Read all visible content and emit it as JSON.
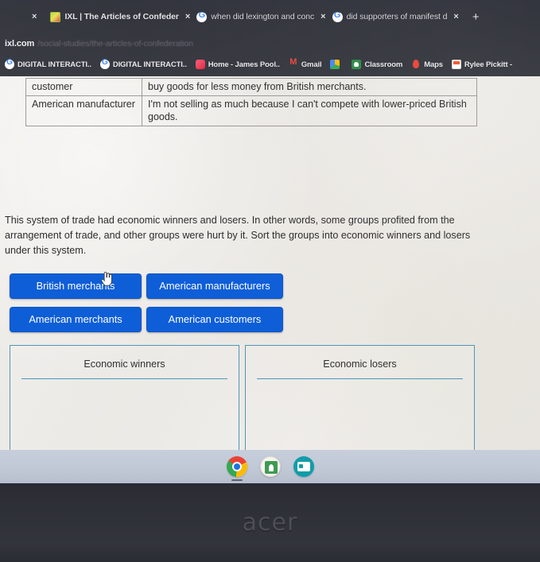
{
  "browser": {
    "tabs": [
      {
        "title": "IXL | The Articles of Confeder",
        "favicon": "ixl-favicon",
        "close_label": "×",
        "active": true
      },
      {
        "title": "when did lexington and conc",
        "favicon": "google-favicon",
        "close_label": "×",
        "active": false
      },
      {
        "title": "did supporters of manifest d",
        "favicon": "google-favicon",
        "close_label": "×",
        "active": false
      }
    ],
    "leading_close_label": "×",
    "new_tab_label": "+",
    "url": {
      "host": "ixl.com",
      "path": "/social-studies/the-articles-of-confederation"
    },
    "bookmarks": [
      {
        "label": "DIGITAL INTERACTI..",
        "icon": "google-icon"
      },
      {
        "label": "DIGITAL INTERACTI..",
        "icon": "google-icon"
      },
      {
        "label": "Home - James Pool..",
        "icon": "pink-icon"
      },
      {
        "label": "Gmail",
        "icon": "gmail-icon"
      },
      {
        "label": "",
        "icon": "drive-icon"
      },
      {
        "label": "Classroom",
        "icon": "classroom-icon"
      },
      {
        "label": "Maps",
        "icon": "maps-icon"
      },
      {
        "label": "Rylee Pickitt - ",
        "icon": "doc-icon"
      }
    ]
  },
  "page": {
    "table": {
      "rows": [
        {
          "role": "customer",
          "quote": "buy goods for less money from British merchants."
        },
        {
          "role": "American manufacturer",
          "quote": "I'm not selling as much because I can't compete with lower-priced British goods."
        }
      ]
    },
    "prompt": "This system of trade had economic winners and losers. In other words, some groups profited from the arrangement of trade, and other groups were hurt by it. Sort the groups into economic winners and losers under this system.",
    "tiles": [
      {
        "label": "British merchants"
      },
      {
        "label": "American manufacturers"
      },
      {
        "label": "American merchants"
      },
      {
        "label": "American customers"
      }
    ],
    "dropzones": [
      {
        "title": "Economic winners",
        "items": []
      },
      {
        "title": "Economic losers",
        "items": []
      }
    ]
  },
  "shelf": {
    "icons": [
      {
        "name": "chrome-icon",
        "label": "Chrome"
      },
      {
        "name": "classroom-icon",
        "label": "Classroom"
      },
      {
        "name": "app-icon",
        "label": "App"
      }
    ]
  },
  "device": {
    "brand": "acer"
  },
  "colors": {
    "tile_blue": "#0e5ed8",
    "dropzone_border": "#4f96b8",
    "page_bg": "#eceae6",
    "shelf_bg": "#c0c8d6",
    "chrome_bg": "#303239"
  }
}
